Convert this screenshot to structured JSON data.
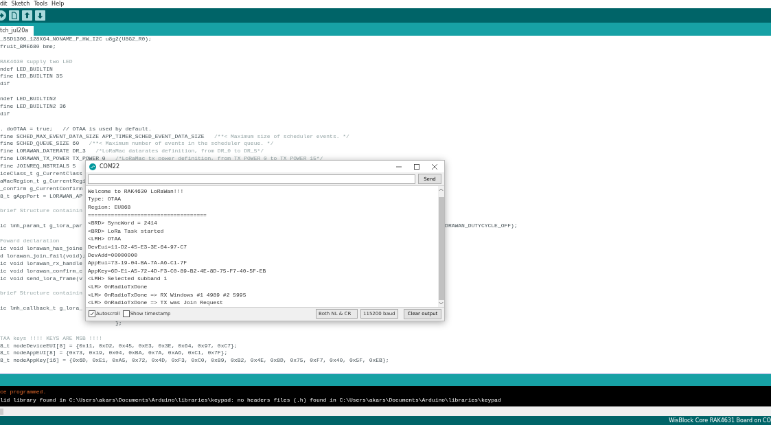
{
  "menu_bar": [
    "dit",
    "Sketch",
    "Tools",
    "Help"
  ],
  "tabs": [
    {
      "label": "tch_jul20a",
      "selected": true
    }
  ],
  "editor": {
    "lines": [
      {
        "kind": "code",
        "text": "_SSD1306_128X64_NONAME_F_HW_I2C u8g2(U8G2_R0);"
      },
      {
        "kind": "code",
        "text": "fruit_BME680 bme;"
      },
      {
        "kind": "blank"
      },
      {
        "kind": "comment",
        "text": "RAK4630 supply two LED"
      },
      {
        "kind": "code",
        "text": "ndef LED_BUILTIN"
      },
      {
        "kind": "code",
        "text": "fine LED_BUILTIN 35"
      },
      {
        "kind": "code",
        "text": "dif"
      },
      {
        "kind": "blank"
      },
      {
        "kind": "code",
        "text": "ndef LED_BUILTIN2"
      },
      {
        "kind": "code",
        "text": "fine LED_BUILTIN2 36"
      },
      {
        "kind": "code",
        "text": "dif"
      },
      {
        "kind": "blank"
      },
      {
        "kind": "code",
        "text": ". doOTAA = true;   // OTAA is used by default."
      },
      {
        "kind": "code",
        "text": "fine SCHED_MAX_EVENT_DATA_SIZE APP_TIMER_SCHED_EVENT_DATA_SIZE",
        "tail": "/**< Maximum size of scheduler events. */"
      },
      {
        "kind": "code",
        "text": "fine SCHED_QUEUE_SIZE 60",
        "tail": "/**< Maximum number of events in the scheduler queue. */"
      },
      {
        "kind": "code",
        "text": "fine LORAWAN_DATERATE DR_3",
        "tail": "/*LoRaMac datarates definition, from DR_0 to DR_5*/"
      },
      {
        "kind": "code",
        "text": "fine LORAWAN_TX_POWER TX_POWER 0",
        "tail": "/*LoRaMac tx power definition, from TX_POWER_0 to TX_POWER_15*/"
      },
      {
        "kind": "code",
        "text": "fine JOINREQ_NBTRIALS 5"
      },
      {
        "kind": "code",
        "text": "iceClass_t g_CurrentClass"
      },
      {
        "kind": "code",
        "text": "aMacRegion_t g_CurrentRegi"
      },
      {
        "kind": "code",
        "text": "_confirm g_CurrentConfirm"
      },
      {
        "kind": "code",
        "text": "8_t gAppPort = LORAWAN_AP"
      },
      {
        "kind": "blank"
      },
      {
        "kind": "comment",
        "text": "brief Structure containin"
      },
      {
        "kind": "blank"
      },
      {
        "kind": "code",
        "text": "ic lmh_param_t g_lora_par",
        "far": "DRAWAN_DUTYCYCLE_OFF);"
      },
      {
        "kind": "blank"
      },
      {
        "kind": "comment",
        "text": "Foward declaration"
      },
      {
        "kind": "code",
        "text": "ic void lorawan_has_joine"
      },
      {
        "kind": "code",
        "text": "d lorawan_join_fail(void);"
      },
      {
        "kind": "code",
        "text": "ic void lorawan_rx_handle"
      },
      {
        "kind": "code",
        "text": "ic void lorawan_confirm_c"
      },
      {
        "kind": "code",
        "text": "ic void send_lora_frame(v"
      },
      {
        "kind": "blank"
      },
      {
        "kind": "comment",
        "text": "brief Structure containin"
      },
      {
        "kind": "blank"
      },
      {
        "kind": "code",
        "text": "ic lmh_callback_t g_lora_"
      },
      {
        "kind": "blank"
      },
      {
        "kind": "code",
        "text": "                                   };"
      },
      {
        "kind": "blank"
      },
      {
        "kind": "comment",
        "text": "TAA keys !!!! KEYS ARE MSB !!!!"
      },
      {
        "kind": "code",
        "text": "8_t nodeDeviceEUI[8] = {0x11, 0xD2, 0x45, 0xE3, 0x3E, 0x64, 0x97, 0xC7};"
      },
      {
        "kind": "code",
        "text": "8_t nodeAppEUI[8] = {0x73, 0x19, 0x04, 0xBA, 0x7A, 0xA6, 0xC1, 0x7F};"
      },
      {
        "kind": "code",
        "text": "8_t nodeAppKey[16] = {0x6D, 0xE1, 0xA5, 0x72, 0x4D, 0xF3, 0xC0, 0x89, 0xB2, 0x4E, 0x8D, 0x75, 0xF7, 0x40, 0x5F, 0xEB};"
      }
    ]
  },
  "serial_monitor": {
    "title": "COM22",
    "send_button": "Send",
    "output": [
      "Welcome to RAK4630 LoRaWan!!!",
      "Type: OTAA",
      "Region: EU868",
      "====================================",
      "<BRD> SyncWord = 2414",
      "<BRD> LoRa Task started",
      "<LMH> OTAA",
      "DevEui=11-D2-45-E3-3E-64-97-C7",
      "DevAdd=00000000",
      "AppEui=73-19-04-BA-7A-A6-C1-7F",
      "AppKey=6D-E1-A5-72-4D-F3-C0-89-B2-4E-8D-75-F7-40-5F-EB",
      "<LMH> Selected subband 1",
      "<LM> OnRadioTxDone",
      "<LM> OnRadioTxDone => RX Windows #1 4989 #2 5995",
      "<LM> OnRadioTxDone => TX was Join Request"
    ],
    "options": [
      {
        "label": "Autoscroll",
        "checked": true
      },
      {
        "label": "Show timestamp",
        "checked": false
      }
    ],
    "line_ending": "Both NL & CR",
    "baud_rate": "115200 baud",
    "clear_button": "Clear output"
  },
  "console": {
    "lines": [
      {
        "kind": "error",
        "text": "ce programmed."
      },
      {
        "kind": "info",
        "text": "lid library found in C:\\Users\\akars\\Documents\\Arduino\\libraries\\keypad: no headers files (.h) found in C:\\Users\\akars\\Documents\\Arduino\\libraries\\keypad"
      }
    ]
  },
  "status_bar": "WisBlock Core RAK4631 Board on CO"
}
